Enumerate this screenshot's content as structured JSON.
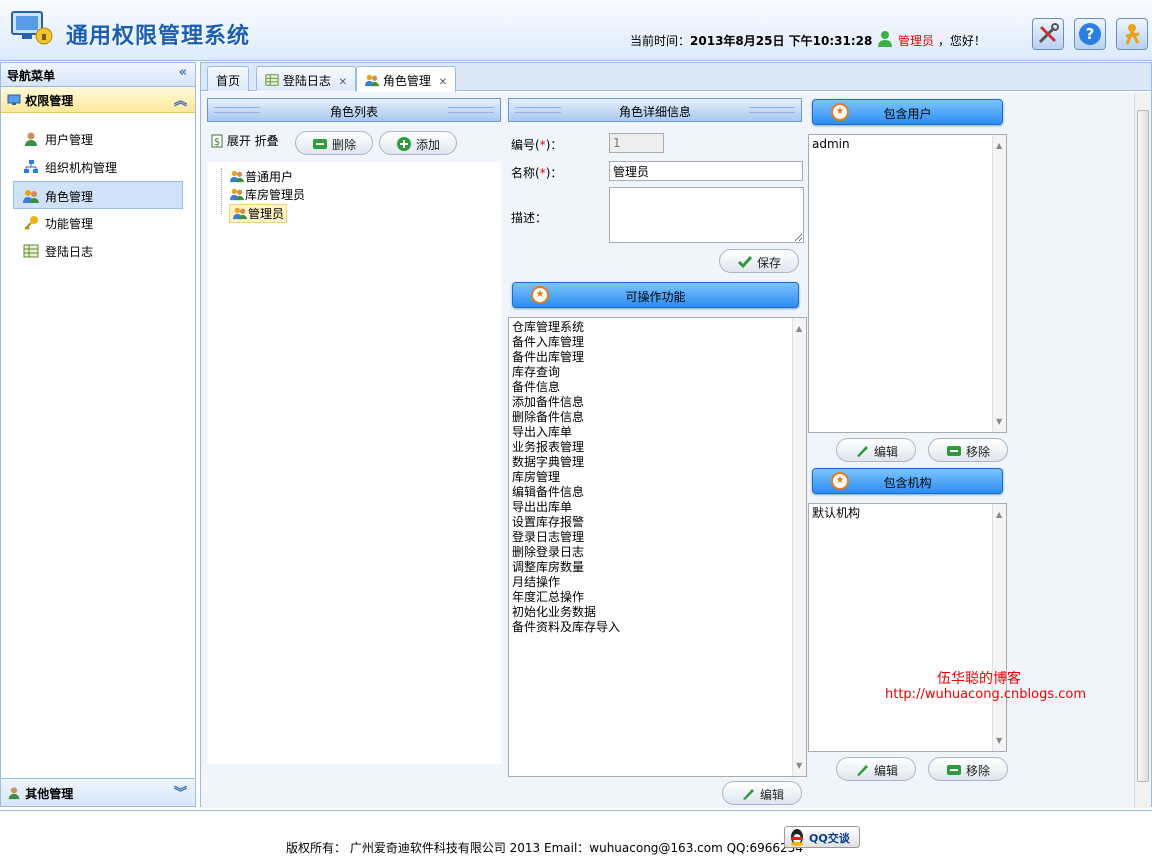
{
  "header": {
    "title": "通用权限管理系统",
    "time_label": "当前时间：",
    "time_value": "2013年8月25日 下午10:31:28",
    "user_name": "管理员",
    "greeting": "，您好！",
    "icons": [
      "tools-icon",
      "help-icon",
      "logout-icon"
    ]
  },
  "nav": {
    "header": "导航菜单",
    "group": "权限管理",
    "items": [
      {
        "label": "用户管理",
        "icon": "user-icon"
      },
      {
        "label": "组织机构管理",
        "icon": "org-icon"
      },
      {
        "label": "角色管理",
        "icon": "role-icon"
      },
      {
        "label": "功能管理",
        "icon": "key-icon"
      },
      {
        "label": "登陆日志",
        "icon": "log-icon"
      }
    ],
    "bottom_group": "其他管理"
  },
  "tabs": [
    {
      "label": "首页"
    },
    {
      "label": "登陆日志"
    },
    {
      "label": "角色管理"
    }
  ],
  "role_list": {
    "title": "角色列表",
    "expand": "展开",
    "collapse": "折叠",
    "delete_btn": "删除",
    "add_btn": "添加",
    "roles": [
      "普通用户",
      "库房管理员",
      "管理员"
    ]
  },
  "detail": {
    "title": "角色详细信息",
    "id_label": "编号(",
    "name_label": "名称(",
    "req_mark": "*",
    "label_suffix": ")：",
    "desc_label": "描述：",
    "id_value": "1",
    "name_value": "管理员",
    "desc_value": "",
    "save_btn": "保存"
  },
  "functions": {
    "title": "可操作功能",
    "items": [
      "仓库管理系统",
      "备件入库管理",
      "备件出库管理",
      "库存查询",
      "备件信息",
      "添加备件信息",
      "删除备件信息",
      "导出入库单",
      "业务报表管理",
      "数据字典管理",
      "库房管理",
      "编辑备件信息",
      "导出出库单",
      "设置库存报警",
      "登录日志管理",
      "删除登录日志",
      "调整库房数量",
      "月结操作",
      "年度汇总操作",
      "初始化业务数据",
      "备件资料及库存导入"
    ],
    "edit_btn": "编辑"
  },
  "users": {
    "title": "包含用户",
    "items": [
      "admin"
    ],
    "edit_btn": "编辑",
    "remove_btn": "移除"
  },
  "orgs": {
    "title": "包含机构",
    "items": [
      "默认机构"
    ],
    "edit_btn": "编辑",
    "remove_btn": "移除"
  },
  "watermark": {
    "line1": "伍华聪的博客",
    "line2": "http://wuhuacong.cnblogs.com"
  },
  "footer": {
    "copyright": "版权所有： 广州爱奇迪软件科技有限公司 2013 Email：wuhuacong@163.com QQ:6966254",
    "qq_btn": "QQ交谈"
  },
  "colors": {
    "accent": "#1a5fb4",
    "border": "#99bbe8",
    "required": "#ee0000",
    "watermark": "#ee0000"
  }
}
